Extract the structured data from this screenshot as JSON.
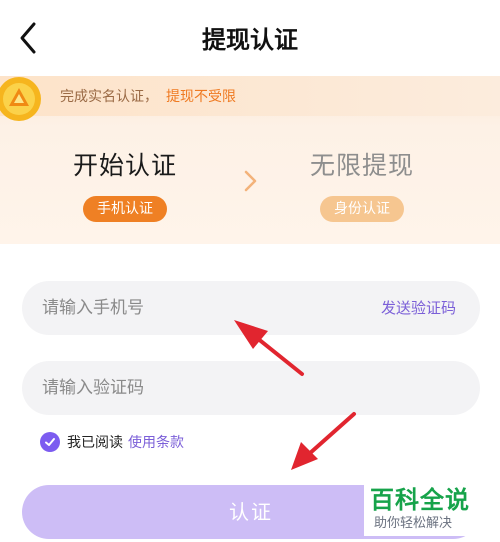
{
  "header": {
    "title": "提现认证",
    "back_icon": "chevron-left-icon"
  },
  "banner": {
    "notice_text": "完成实名认证，",
    "notice_accent": "提现不受限",
    "notice_icon": "gold-coin-icon",
    "steps": [
      {
        "title": "开始认证",
        "tag": "手机认证",
        "state": "active"
      },
      {
        "title": "无限提现",
        "tag": "身份认证",
        "state": "inactive"
      }
    ],
    "divider_icon": "chevron-right-icon"
  },
  "form": {
    "phone_placeholder": "请输入手机号",
    "phone_value": "",
    "send_code_label": "发送验证码",
    "code_placeholder": "请输入验证码",
    "code_value": ""
  },
  "agreement": {
    "checked": true,
    "text": "我已阅读",
    "link": "使用条款"
  },
  "submit": {
    "label": "认证"
  },
  "watermark": {
    "title": "百科全说",
    "subtitle": "助你轻松解决"
  },
  "colors": {
    "accent_orange": "#ef8024",
    "accent_purple": "#7b5fd8",
    "button_disabled": "#cdbdf6",
    "arrow_red": "#e1252f"
  }
}
